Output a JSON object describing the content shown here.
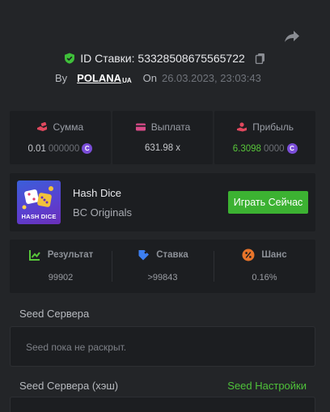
{
  "bet": {
    "id_label": "ID Ставки: 53328508675565722",
    "by_label": "By",
    "user_name": "POLANA",
    "user_suffix": "UA",
    "on_label": "On",
    "date": "26.03.2023, 23:03:43"
  },
  "stats": [
    {
      "label": "Сумма",
      "value_main": "0.01",
      "value_dim": "000000",
      "coin": "C",
      "icon": "money-hand-icon"
    },
    {
      "label": "Выплата",
      "value_main": "631.98 x",
      "icon": "card-icon"
    },
    {
      "label": "Прибыль",
      "value_main": "6.3098",
      "value_dim": "0000",
      "coin": "C",
      "icon": "profit-hand-icon"
    }
  ],
  "game": {
    "name": "Hash Dice",
    "provider": "BC Originals",
    "thumb_label": "HASH DICE",
    "play_label": "Играть Сейчас"
  },
  "results": [
    {
      "label": "Результат",
      "value": "99902",
      "icon": "result-chart-icon",
      "color": "#58c63a"
    },
    {
      "label": "Ставка",
      "value": ">99843",
      "icon": "tag-icon",
      "color": "#3d7ff0"
    },
    {
      "label": "Шанс",
      "value": "0.16%",
      "icon": "percent-icon",
      "color": "#e8742a"
    }
  ],
  "seed": {
    "server_label": "Seed Сервера",
    "server_placeholder": "Seed пока не раскрыт.",
    "hash_label": "Seed Сервера (хэш)",
    "settings_link": "Seed Настройки"
  },
  "colors": {
    "background": "#232528",
    "panel": "#1c1e21",
    "accent_green": "#3cb232",
    "coin_purple": "#7a4dd8"
  }
}
